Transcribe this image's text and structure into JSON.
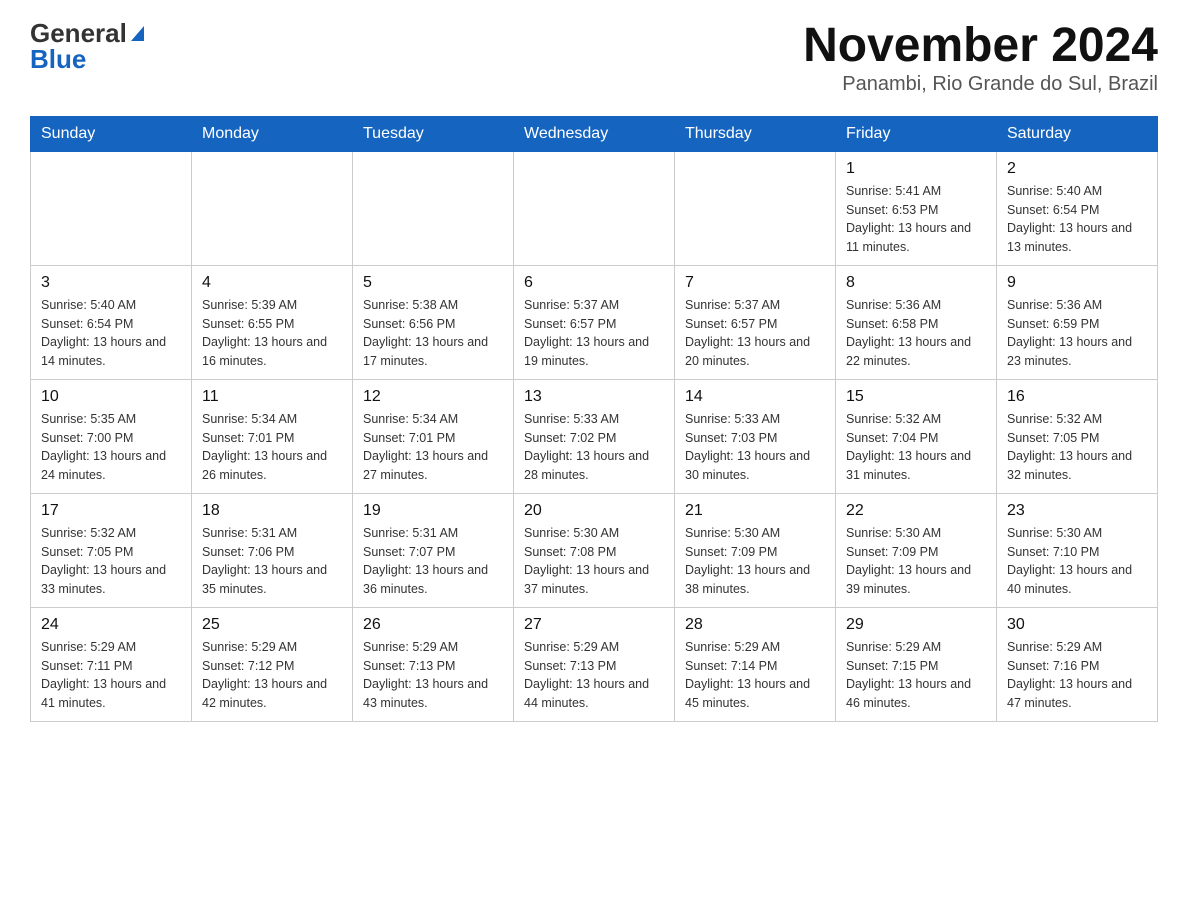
{
  "logo": {
    "general": "General",
    "blue": "Blue"
  },
  "header": {
    "month": "November 2024",
    "location": "Panambi, Rio Grande do Sul, Brazil"
  },
  "days_of_week": [
    "Sunday",
    "Monday",
    "Tuesday",
    "Wednesday",
    "Thursday",
    "Friday",
    "Saturday"
  ],
  "weeks": [
    [
      {
        "day": "",
        "sunrise": "",
        "sunset": "",
        "daylight": ""
      },
      {
        "day": "",
        "sunrise": "",
        "sunset": "",
        "daylight": ""
      },
      {
        "day": "",
        "sunrise": "",
        "sunset": "",
        "daylight": ""
      },
      {
        "day": "",
        "sunrise": "",
        "sunset": "",
        "daylight": ""
      },
      {
        "day": "",
        "sunrise": "",
        "sunset": "",
        "daylight": ""
      },
      {
        "day": "1",
        "sunrise": "Sunrise: 5:41 AM",
        "sunset": "Sunset: 6:53 PM",
        "daylight": "Daylight: 13 hours and 11 minutes."
      },
      {
        "day": "2",
        "sunrise": "Sunrise: 5:40 AM",
        "sunset": "Sunset: 6:54 PM",
        "daylight": "Daylight: 13 hours and 13 minutes."
      }
    ],
    [
      {
        "day": "3",
        "sunrise": "Sunrise: 5:40 AM",
        "sunset": "Sunset: 6:54 PM",
        "daylight": "Daylight: 13 hours and 14 minutes."
      },
      {
        "day": "4",
        "sunrise": "Sunrise: 5:39 AM",
        "sunset": "Sunset: 6:55 PM",
        "daylight": "Daylight: 13 hours and 16 minutes."
      },
      {
        "day": "5",
        "sunrise": "Sunrise: 5:38 AM",
        "sunset": "Sunset: 6:56 PM",
        "daylight": "Daylight: 13 hours and 17 minutes."
      },
      {
        "day": "6",
        "sunrise": "Sunrise: 5:37 AM",
        "sunset": "Sunset: 6:57 PM",
        "daylight": "Daylight: 13 hours and 19 minutes."
      },
      {
        "day": "7",
        "sunrise": "Sunrise: 5:37 AM",
        "sunset": "Sunset: 6:57 PM",
        "daylight": "Daylight: 13 hours and 20 minutes."
      },
      {
        "day": "8",
        "sunrise": "Sunrise: 5:36 AM",
        "sunset": "Sunset: 6:58 PM",
        "daylight": "Daylight: 13 hours and 22 minutes."
      },
      {
        "day": "9",
        "sunrise": "Sunrise: 5:36 AM",
        "sunset": "Sunset: 6:59 PM",
        "daylight": "Daylight: 13 hours and 23 minutes."
      }
    ],
    [
      {
        "day": "10",
        "sunrise": "Sunrise: 5:35 AM",
        "sunset": "Sunset: 7:00 PM",
        "daylight": "Daylight: 13 hours and 24 minutes."
      },
      {
        "day": "11",
        "sunrise": "Sunrise: 5:34 AM",
        "sunset": "Sunset: 7:01 PM",
        "daylight": "Daylight: 13 hours and 26 minutes."
      },
      {
        "day": "12",
        "sunrise": "Sunrise: 5:34 AM",
        "sunset": "Sunset: 7:01 PM",
        "daylight": "Daylight: 13 hours and 27 minutes."
      },
      {
        "day": "13",
        "sunrise": "Sunrise: 5:33 AM",
        "sunset": "Sunset: 7:02 PM",
        "daylight": "Daylight: 13 hours and 28 minutes."
      },
      {
        "day": "14",
        "sunrise": "Sunrise: 5:33 AM",
        "sunset": "Sunset: 7:03 PM",
        "daylight": "Daylight: 13 hours and 30 minutes."
      },
      {
        "day": "15",
        "sunrise": "Sunrise: 5:32 AM",
        "sunset": "Sunset: 7:04 PM",
        "daylight": "Daylight: 13 hours and 31 minutes."
      },
      {
        "day": "16",
        "sunrise": "Sunrise: 5:32 AM",
        "sunset": "Sunset: 7:05 PM",
        "daylight": "Daylight: 13 hours and 32 minutes."
      }
    ],
    [
      {
        "day": "17",
        "sunrise": "Sunrise: 5:32 AM",
        "sunset": "Sunset: 7:05 PM",
        "daylight": "Daylight: 13 hours and 33 minutes."
      },
      {
        "day": "18",
        "sunrise": "Sunrise: 5:31 AM",
        "sunset": "Sunset: 7:06 PM",
        "daylight": "Daylight: 13 hours and 35 minutes."
      },
      {
        "day": "19",
        "sunrise": "Sunrise: 5:31 AM",
        "sunset": "Sunset: 7:07 PM",
        "daylight": "Daylight: 13 hours and 36 minutes."
      },
      {
        "day": "20",
        "sunrise": "Sunrise: 5:30 AM",
        "sunset": "Sunset: 7:08 PM",
        "daylight": "Daylight: 13 hours and 37 minutes."
      },
      {
        "day": "21",
        "sunrise": "Sunrise: 5:30 AM",
        "sunset": "Sunset: 7:09 PM",
        "daylight": "Daylight: 13 hours and 38 minutes."
      },
      {
        "day": "22",
        "sunrise": "Sunrise: 5:30 AM",
        "sunset": "Sunset: 7:09 PM",
        "daylight": "Daylight: 13 hours and 39 minutes."
      },
      {
        "day": "23",
        "sunrise": "Sunrise: 5:30 AM",
        "sunset": "Sunset: 7:10 PM",
        "daylight": "Daylight: 13 hours and 40 minutes."
      }
    ],
    [
      {
        "day": "24",
        "sunrise": "Sunrise: 5:29 AM",
        "sunset": "Sunset: 7:11 PM",
        "daylight": "Daylight: 13 hours and 41 minutes."
      },
      {
        "day": "25",
        "sunrise": "Sunrise: 5:29 AM",
        "sunset": "Sunset: 7:12 PM",
        "daylight": "Daylight: 13 hours and 42 minutes."
      },
      {
        "day": "26",
        "sunrise": "Sunrise: 5:29 AM",
        "sunset": "Sunset: 7:13 PM",
        "daylight": "Daylight: 13 hours and 43 minutes."
      },
      {
        "day": "27",
        "sunrise": "Sunrise: 5:29 AM",
        "sunset": "Sunset: 7:13 PM",
        "daylight": "Daylight: 13 hours and 44 minutes."
      },
      {
        "day": "28",
        "sunrise": "Sunrise: 5:29 AM",
        "sunset": "Sunset: 7:14 PM",
        "daylight": "Daylight: 13 hours and 45 minutes."
      },
      {
        "day": "29",
        "sunrise": "Sunrise: 5:29 AM",
        "sunset": "Sunset: 7:15 PM",
        "daylight": "Daylight: 13 hours and 46 minutes."
      },
      {
        "day": "30",
        "sunrise": "Sunrise: 5:29 AM",
        "sunset": "Sunset: 7:16 PM",
        "daylight": "Daylight: 13 hours and 47 minutes."
      }
    ]
  ]
}
